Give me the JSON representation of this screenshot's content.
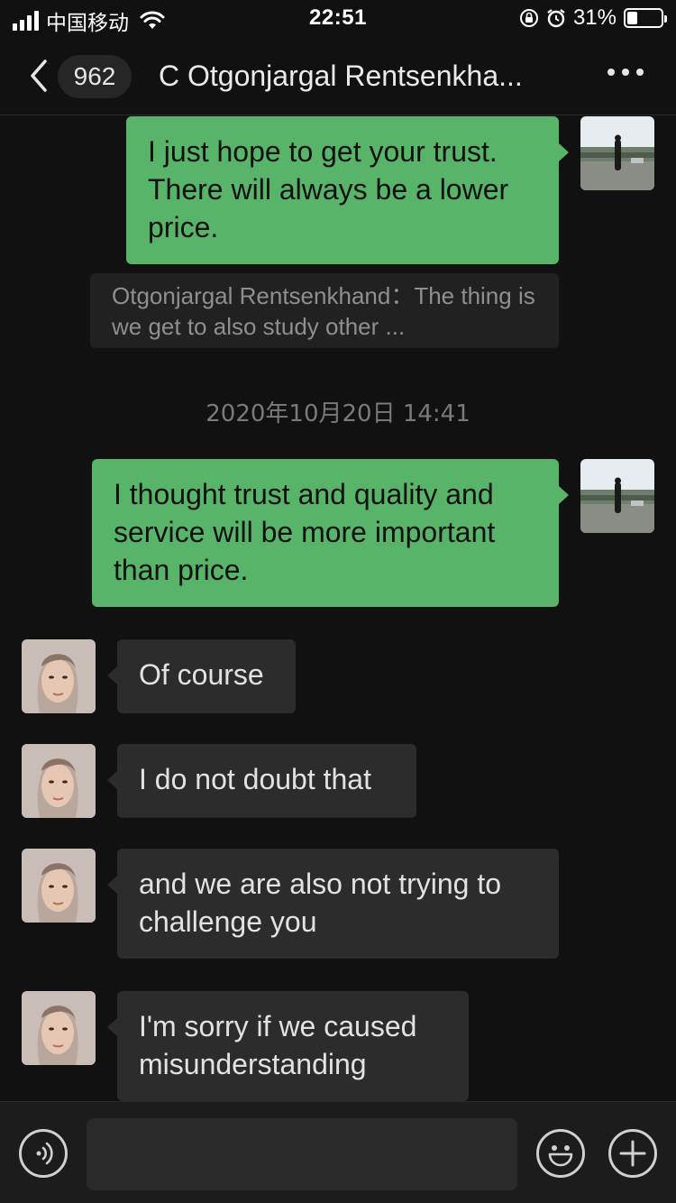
{
  "status_bar": {
    "carrier": "中国移动",
    "time": "22:51",
    "battery_percent": "31%",
    "battery_level": 0.31
  },
  "nav": {
    "unread_count": "962",
    "title": "C Otgonjargal Rentsenkha..."
  },
  "messages": [
    {
      "from": "me",
      "text": "I just hope to get your trust. There will always be a lower price."
    },
    {
      "type": "quote",
      "text": "Otgonjargal Rentsenkhand：The thing is we get to also study other ..."
    },
    {
      "type": "timestamp",
      "text": "2020年10月20日 14:41"
    },
    {
      "from": "me",
      "text": "I thought trust and quality and service will be more important than price."
    },
    {
      "from": "other",
      "text": "Of course"
    },
    {
      "from": "other",
      "text": "I do not doubt that"
    },
    {
      "from": "other",
      "text": "and we are also not trying to challenge you"
    },
    {
      "from": "other",
      "text": "I'm sorry if we caused misunderstanding"
    }
  ],
  "input": {
    "value": "",
    "placeholder": ""
  },
  "icons": {
    "back": "chevron-left-icon",
    "more": "more-dots-icon",
    "voice": "voice-icon",
    "emoji": "emoji-icon",
    "add": "plus-icon"
  },
  "colors": {
    "background": "#111111",
    "my_bubble": "#58b468",
    "other_bubble": "#2c2c2c"
  }
}
